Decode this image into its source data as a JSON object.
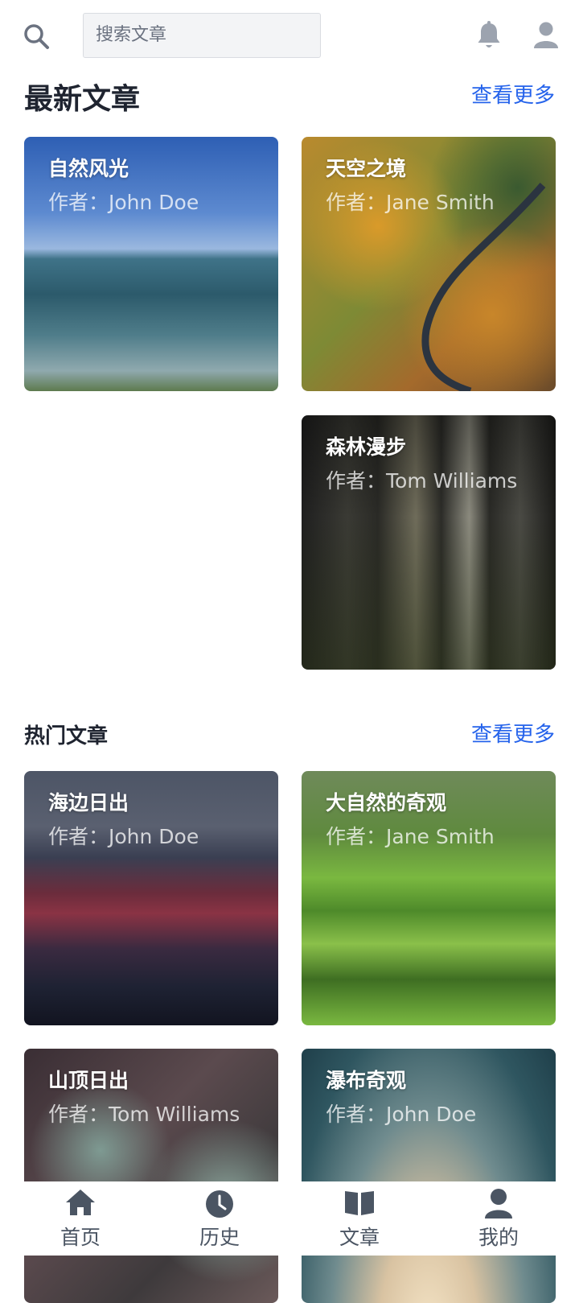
{
  "header": {
    "search_placeholder": "搜索文章"
  },
  "latest": {
    "title": "最新文章",
    "more": "查看更多",
    "cards": [
      {
        "title": "自然风光",
        "author": "作者：John Doe"
      },
      {
        "title": "天空之境",
        "author": "作者：Jane Smith"
      },
      {
        "title": "森林漫步",
        "author": "作者：Tom Williams"
      }
    ]
  },
  "popular": {
    "title": "热门文章",
    "more": "查看更多",
    "cards": [
      {
        "title": "海边日出",
        "author": "作者：John Doe"
      },
      {
        "title": "大自然的奇观",
        "author": "作者：Jane Smith"
      },
      {
        "title": "山顶日出",
        "author": "作者：Tom Williams"
      },
      {
        "title": "瀑布奇观",
        "author": "作者：John Doe"
      }
    ]
  },
  "tabbar": {
    "items": [
      {
        "label": "首页",
        "icon": "home-icon"
      },
      {
        "label": "历史",
        "icon": "clock-icon"
      },
      {
        "label": "文章",
        "icon": "book-icon"
      },
      {
        "label": "我的",
        "icon": "user-icon"
      }
    ]
  }
}
